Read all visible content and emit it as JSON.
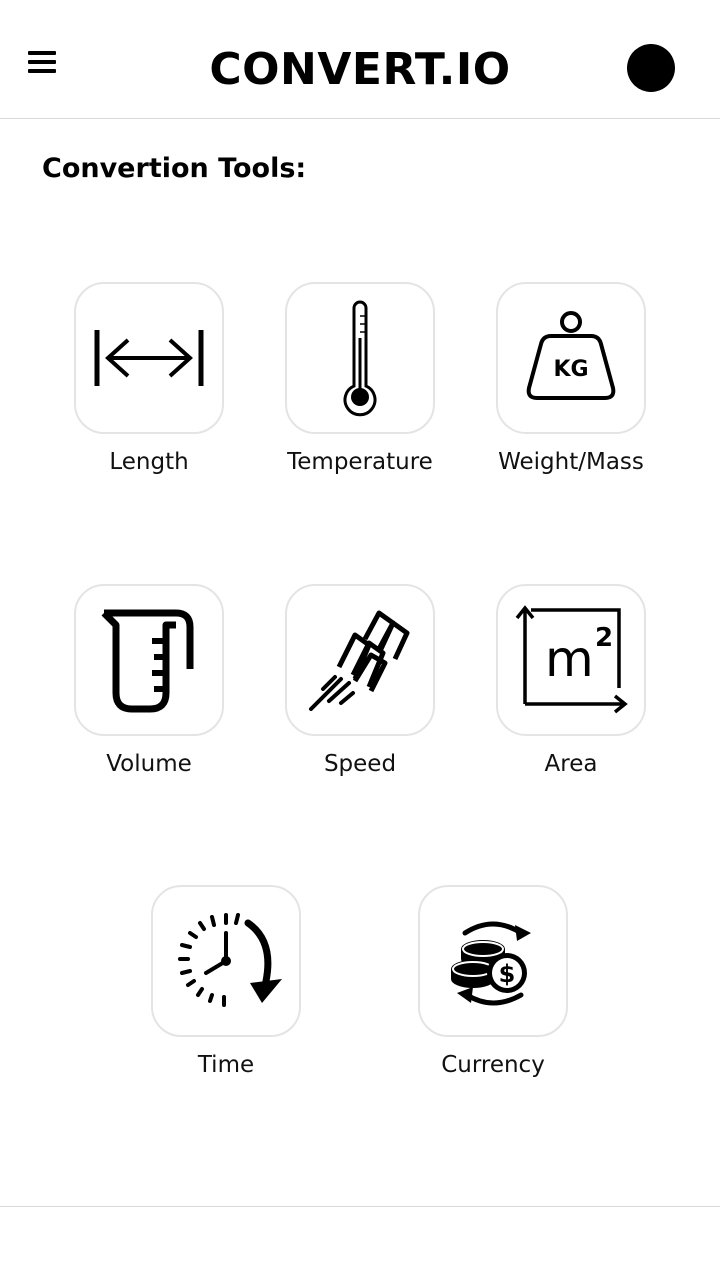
{
  "header": {
    "title": "CONVERT.IO",
    "menu_icon": "hamburger-menu-icon",
    "profile_icon": "profile-avatar"
  },
  "section": {
    "title": "Convertion Tools:"
  },
  "tools": [
    {
      "label": "Length",
      "icon": "length-arrow-icon"
    },
    {
      "label": "Temperature",
      "icon": "thermometer-icon"
    },
    {
      "label": "Weight/Mass",
      "icon": "kg-weight-icon"
    },
    {
      "label": "Volume",
      "icon": "measuring-cup-icon"
    },
    {
      "label": "Speed",
      "icon": "speed-lines-icon"
    },
    {
      "label": "Area",
      "icon": "area-m2-icon"
    },
    {
      "label": "Time",
      "icon": "clock-arrow-icon"
    },
    {
      "label": "Currency",
      "icon": "coins-exchange-icon"
    }
  ],
  "area_unit": {
    "base": "m",
    "exponent": "2"
  },
  "weight_unit": "KG",
  "currency_symbol": "$",
  "colors": {
    "tile_border": "#e4e4e4",
    "divider": "#d9d9d9",
    "icon": "#000000"
  }
}
